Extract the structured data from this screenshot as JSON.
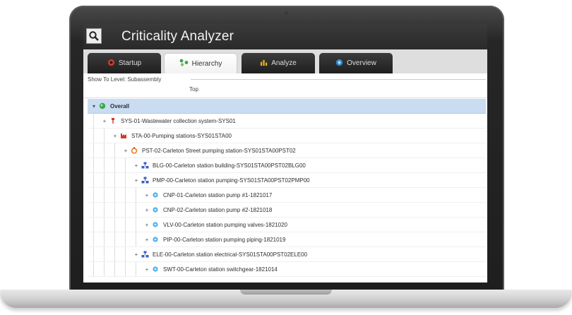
{
  "app": {
    "title": "Criticality Analyzer",
    "icon": "magnifier-icon"
  },
  "tabs": [
    {
      "label": "Startup",
      "icon": "power-icon",
      "active": false
    },
    {
      "label": "Hierarchy",
      "icon": "hierarchy-icon",
      "active": true
    },
    {
      "label": "Analyze",
      "icon": "bar-chart-icon",
      "active": false
    },
    {
      "label": "Overview",
      "icon": "globe-icon",
      "active": false
    }
  ],
  "level": {
    "label": "Show To Level: Subassembly",
    "top_label": "Top"
  },
  "tree": [
    {
      "label": "Overall",
      "depth": 0,
      "icon": "globe-icon",
      "toggle": "▾",
      "selected": true
    },
    {
      "label": "SYS-01-Wastewater collection system-SYS01",
      "depth": 1,
      "icon": "system-icon",
      "toggle": "+"
    },
    {
      "label": "STA-00-Pumping stations-SYS01STA00",
      "depth": 2,
      "icon": "factory-icon",
      "toggle": "+"
    },
    {
      "label": "PST-02-Carleton Street pumping station-SYS01STA00PST02",
      "depth": 3,
      "icon": "station-icon",
      "toggle": "+"
    },
    {
      "label": "BLG-00-Carleton station building-SYS01STA00PST02BLG00",
      "depth": 4,
      "icon": "group-icon",
      "toggle": "+"
    },
    {
      "label": "PMP-00-Carleton station pumping-SYS01STA00PST02PMP00",
      "depth": 4,
      "icon": "group-icon",
      "toggle": "+"
    },
    {
      "label": "CNP-01-Carleton station pump #1-1821017",
      "depth": 5,
      "icon": "asset-icon",
      "toggle": "+"
    },
    {
      "label": "CNP-02-Carleton station pump #2-1821018",
      "depth": 5,
      "icon": "asset-icon",
      "toggle": "+"
    },
    {
      "label": "VLV-00-Carleton station pumping valves-1821020",
      "depth": 5,
      "icon": "asset-icon",
      "toggle": "+"
    },
    {
      "label": "PIP-00-Carleton station pumping piping-1821019",
      "depth": 5,
      "icon": "asset-icon",
      "toggle": "+"
    },
    {
      "label": "ELE-00-Carleton station electrical-SYS01STA00PST02ELE00",
      "depth": 4,
      "icon": "group-icon",
      "toggle": "+"
    },
    {
      "label": "SWT-00-Carleton station switchgear-1821014",
      "depth": 5,
      "icon": "asset-icon",
      "toggle": "+"
    }
  ],
  "colors": {
    "selected_row": "#c9dcf2",
    "titlebar": "#2f2f2f",
    "power": "#d23a2a",
    "hierarchy": "#3aa84a",
    "analyze": "#e8b020",
    "overview": "#2f8fd8"
  }
}
